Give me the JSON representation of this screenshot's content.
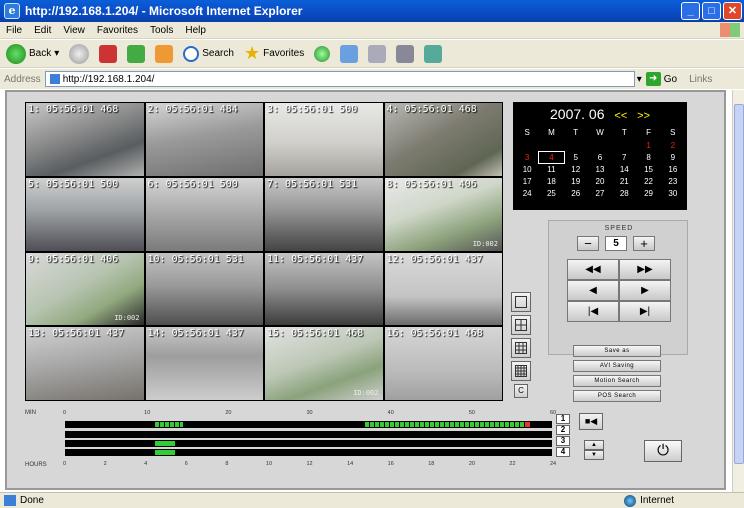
{
  "window": {
    "title": "http://192.168.1.204/ - Microsoft Internet Explorer"
  },
  "menu": [
    "File",
    "Edit",
    "View",
    "Favorites",
    "Tools",
    "Help"
  ],
  "toolbar": {
    "back_label": "Back",
    "search_label": "Search",
    "favorites_label": "Favorites"
  },
  "address": {
    "label": "Address",
    "url": "http://192.168.1.204/",
    "go_label": "Go",
    "links_label": "Links"
  },
  "status": {
    "left": "Done",
    "zone": "Internet"
  },
  "cameras": [
    {
      "label": "1: 05:56:01 468",
      "bg": "linear-gradient(160deg,#c9c9c9 0%,#8c8c8c 40%,#585d60 70%,#b0b0ae 100%)"
    },
    {
      "label": "2: 05:56:01 484",
      "bg": "linear-gradient(170deg,#d6d6d6 0%,#9a9a9a 45%,#6f6f6f 100%)"
    },
    {
      "label": "3: 05:56:01 500",
      "bg": "linear-gradient(180deg,#e8e8e6 0%,#d0cfca 55%,#a5a39c 100%)"
    },
    {
      "label": "4: 05:56:01 468",
      "bg": "linear-gradient(150deg,#b9b9b3 0%,#7d7b70 45%,#5f6654 80%,#c3c0b4 100%)"
    },
    {
      "label": "5: 05:56:01 500",
      "bg": "linear-gradient(180deg,#cfcfcf 0%,#9da2a5 45%,#4f4f55 100%)"
    },
    {
      "label": "6: 05:56:01 500",
      "bg": "linear-gradient(180deg,#d5d5d5 0%,#a7a7a7 50%,#7b7b7b 100%)"
    },
    {
      "label": "7: 05:56:01 531",
      "bg": "linear-gradient(180deg,#c8c8c8 0%,#9a9a9a 40%,#444 100%)"
    },
    {
      "label": "8: 05:56:01 406",
      "bg": "linear-gradient(160deg,#e9e9e9 0%,#cfd7c9 40%,#8ea37d 70%,#555 100%)",
      "stamp": "ID:002"
    },
    {
      "label": "9: 05:56:01 406",
      "bg": "linear-gradient(150deg,#d9d9d9 0%,#b7c4b1 45%,#92a97f 70%,#2a2a2a 100%)",
      "stamp": "ID:002"
    },
    {
      "label": "10: 05:56:01 531",
      "bg": "linear-gradient(180deg,#c2c2c2 0%,#9a9a9a 45%,#4f4f4f 100%)"
    },
    {
      "label": "11: 05:56:01 437",
      "bg": "linear-gradient(180deg,#c4c4c4 0%,#8e8e8e 50%,#3c3c3c 100%)"
    },
    {
      "label": "12: 05:56:01 437",
      "bg": "linear-gradient(180deg,#dadada 0%,#c4c4c4 60%,#6c6c6c 100%)"
    },
    {
      "label": "13: 05:56:01 437",
      "bg": "linear-gradient(170deg,#d2d2d2 0%,#a9a9a9 45%,#76716a 100%)"
    },
    {
      "label": "14: 05:56:01 437",
      "bg": "linear-gradient(180deg,#c9c9c9 0%,#9d9d9d 40%,#cdcdcd 100%)"
    },
    {
      "label": "15: 05:56:01 468",
      "bg": "linear-gradient(160deg,#e3e3e3 0%,#bcc7b5 45%,#8aa27c 70%,#cfcfcf 100%)",
      "stamp": "ID:002"
    },
    {
      "label": "16: 05:56:01 468",
      "bg": "linear-gradient(180deg,#d6d6d6 0%,#bbbbbb 60%,#a0a0a0 100%)"
    }
  ],
  "calendar": {
    "month": "2007. 06",
    "prev": "<<",
    "next": ">>",
    "weekdays": [
      "S",
      "M",
      "T",
      "W",
      "T",
      "F",
      "S"
    ],
    "days": [
      [
        "",
        "",
        "",
        "",
        "",
        "1",
        "2"
      ],
      [
        "3",
        "4",
        "5",
        "6",
        "7",
        "8",
        "9"
      ],
      [
        "10",
        "11",
        "12",
        "13",
        "14",
        "15",
        "16"
      ],
      [
        "17",
        "18",
        "19",
        "20",
        "21",
        "22",
        "23"
      ],
      [
        "24",
        "25",
        "26",
        "27",
        "28",
        "29",
        "30"
      ]
    ],
    "selected": "4",
    "red_days": [
      "1",
      "2",
      "3",
      "4"
    ]
  },
  "speed": {
    "label": "SPEED",
    "value": "5",
    "minus": "−",
    "plus": "+"
  },
  "playback": [
    "◀◀",
    "▶▶",
    "◀",
    "▶",
    "|◀",
    "▶|"
  ],
  "actions": {
    "save_as": "Save as",
    "avi_saving": "AVI Saving",
    "motion_search": "Motion Search",
    "pos_search": "POS Search"
  },
  "timeline": {
    "min_label": "MIN",
    "hours_label": "HOURS",
    "minute_ticks": [
      "0",
      "10",
      "20",
      "30",
      "40",
      "50",
      "60"
    ],
    "hour_ticks": [
      "0",
      "2",
      "4",
      "6",
      "8",
      "10",
      "12",
      "14",
      "16",
      "18",
      "20",
      "22",
      "24"
    ],
    "channels": [
      "1",
      "2",
      "3",
      "4"
    ],
    "layout_c": "C"
  }
}
